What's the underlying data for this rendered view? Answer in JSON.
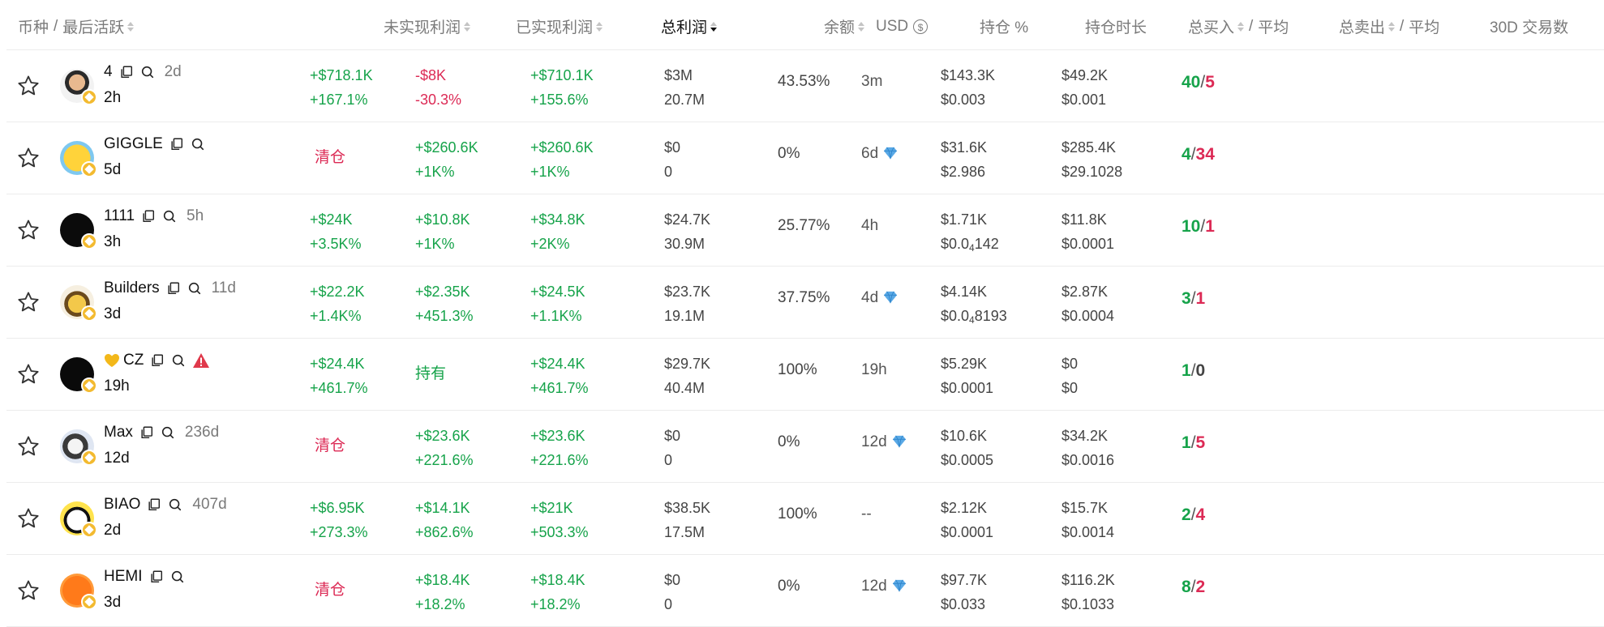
{
  "header": {
    "token_col": "币种",
    "last_active": "最后活跃",
    "unrealized": "未实现利润",
    "realized": "已实现利润",
    "total_profit": "总利润",
    "balance": "余额",
    "currency": "USD",
    "currency_symbol": "$",
    "holding_pct": "持仓 %",
    "hold_duration": "持仓时长",
    "total_buy": "总买入",
    "buy_avg": "平均",
    "total_sell": "总卖出",
    "sell_avg": "平均",
    "trades_30d": "30D 交易数"
  },
  "colors": {
    "green": "#16a34a",
    "red": "#dc2a55",
    "bnb": "#f3ba2f"
  },
  "rows": [
    {
      "name": "4",
      "age": "2d",
      "last_active": "2h",
      "unrealized": {
        "mode": "two",
        "v1": "+$718.1K",
        "v2": "+167.1%",
        "c1": "g",
        "c2": "g"
      },
      "realized": {
        "mode": "two",
        "v1": "-$8K",
        "v2": "-30.3%",
        "c1": "r",
        "c2": "r"
      },
      "total": {
        "v1": "+$710.1K",
        "v2": "+155.6%"
      },
      "balance": {
        "v1": "$3M",
        "v2": "20.7M"
      },
      "holding_pct": "43.53%",
      "hold_duration": "3m",
      "diamond": false,
      "buy": {
        "v1": "$143.3K",
        "v2": "$0.003"
      },
      "sell": {
        "v1": "$49.2K",
        "v2": "$0.001"
      },
      "trades": {
        "buys": "40",
        "sells": "5"
      },
      "avatar": "man",
      "warn": false,
      "heart": false
    },
    {
      "name": "GIGGLE",
      "age": "",
      "last_active": "5d",
      "unrealized": {
        "mode": "one",
        "v1": "清仓",
        "c1": "r"
      },
      "realized": {
        "mode": "two",
        "v1": "+$260.6K",
        "v2": "+1K%",
        "c1": "g",
        "c2": "g"
      },
      "total": {
        "v1": "+$260.6K",
        "v2": "+1K%"
      },
      "balance": {
        "v1": "$0",
        "v2": "0"
      },
      "holding_pct": "0%",
      "hold_duration": "6d",
      "diamond": true,
      "buy": {
        "v1": "$31.6K",
        "v2": "$2.986"
      },
      "sell": {
        "v1": "$285.4K",
        "v2": "$29.1028"
      },
      "trades": {
        "buys": "4",
        "sells": "34"
      },
      "avatar": "giggle",
      "warn": false,
      "heart": false
    },
    {
      "name": "1111",
      "age": "5h",
      "last_active": "3h",
      "unrealized": {
        "mode": "two",
        "v1": "+$24K",
        "v2": "+3.5K%",
        "c1": "g",
        "c2": "g"
      },
      "realized": {
        "mode": "two",
        "v1": "+$10.8K",
        "v2": "+1K%",
        "c1": "g",
        "c2": "g"
      },
      "total": {
        "v1": "+$34.8K",
        "v2": "+2K%"
      },
      "balance": {
        "v1": "$24.7K",
        "v2": "30.9M"
      },
      "holding_pct": "25.77%",
      "hold_duration": "4h",
      "diamond": false,
      "buy": {
        "v1": "$1.71K",
        "v2_pre": "$0.0",
        "v2_sub": "4",
        "v2_post": "142"
      },
      "sell": {
        "v1": "$11.8K",
        "v2": "$0.0001"
      },
      "trades": {
        "buys": "10",
        "sells": "1"
      },
      "avatar": "dark",
      "warn": false,
      "heart": false
    },
    {
      "name": "Builders",
      "age": "11d",
      "last_active": "3d",
      "unrealized": {
        "mode": "two",
        "v1": "+$22.2K",
        "v2": "+1.4K%",
        "c1": "g",
        "c2": "g"
      },
      "realized": {
        "mode": "two",
        "v1": "+$2.35K",
        "v2": "+451.3%",
        "c1": "g",
        "c2": "g"
      },
      "total": {
        "v1": "+$24.5K",
        "v2": "+1.1K%"
      },
      "balance": {
        "v1": "$23.7K",
        "v2": "19.1M"
      },
      "holding_pct": "37.75%",
      "hold_duration": "4d",
      "diamond": true,
      "buy": {
        "v1": "$4.14K",
        "v2_pre": "$0.0",
        "v2_sub": "4",
        "v2_post": "8193"
      },
      "sell": {
        "v1": "$2.87K",
        "v2": "$0.0004"
      },
      "trades": {
        "buys": "3",
        "sells": "1"
      },
      "avatar": "builder",
      "warn": false,
      "heart": false
    },
    {
      "name": "CZ",
      "age": "",
      "last_active": "19h",
      "unrealized": {
        "mode": "two",
        "v1": "+$24.4K",
        "v2": "+461.7%",
        "c1": "g",
        "c2": "g"
      },
      "realized": {
        "mode": "one",
        "v1": "持有",
        "c1": "g"
      },
      "total": {
        "v1": "+$24.4K",
        "v2": "+461.7%"
      },
      "balance": {
        "v1": "$29.7K",
        "v2": "40.4M"
      },
      "holding_pct": "100%",
      "hold_duration": "19h",
      "diamond": false,
      "buy": {
        "v1": "$5.29K",
        "v2": "$0.0001"
      },
      "sell": {
        "v1": "$0",
        "v2": "$0"
      },
      "trades": {
        "buys": "1",
        "sells": "0"
      },
      "avatar": "cz",
      "warn": true,
      "heart": true
    },
    {
      "name": "Max",
      "age": "236d",
      "last_active": "12d",
      "unrealized": {
        "mode": "one",
        "v1": "清仓",
        "c1": "r"
      },
      "realized": {
        "mode": "two",
        "v1": "+$23.6K",
        "v2": "+221.6%",
        "c1": "g",
        "c2": "g"
      },
      "total": {
        "v1": "+$23.6K",
        "v2": "+221.6%"
      },
      "balance": {
        "v1": "$0",
        "v2": "0"
      },
      "holding_pct": "0%",
      "hold_duration": "12d",
      "diamond": true,
      "buy": {
        "v1": "$10.6K",
        "v2": "$0.0005"
      },
      "sell": {
        "v1": "$34.2K",
        "v2": "$0.0016"
      },
      "trades": {
        "buys": "1",
        "sells": "5"
      },
      "avatar": "max",
      "warn": false,
      "heart": false
    },
    {
      "name": "BIAO",
      "age": "407d",
      "last_active": "2d",
      "unrealized": {
        "mode": "two",
        "v1": "+$6.95K",
        "v2": "+273.3%",
        "c1": "g",
        "c2": "g"
      },
      "realized": {
        "mode": "two",
        "v1": "+$14.1K",
        "v2": "+862.6%",
        "c1": "g",
        "c2": "g"
      },
      "total": {
        "v1": "+$21K",
        "v2": "+503.3%"
      },
      "balance": {
        "v1": "$38.5K",
        "v2": "17.5M"
      },
      "holding_pct": "100%",
      "hold_duration": "--",
      "diamond": false,
      "buy": {
        "v1": "$2.12K",
        "v2": "$0.0001"
      },
      "sell": {
        "v1": "$15.7K",
        "v2": "$0.0014"
      },
      "trades": {
        "buys": "2",
        "sells": "4"
      },
      "avatar": "panda",
      "warn": false,
      "heart": false
    },
    {
      "name": "HEMI",
      "age": "",
      "last_active": "3d",
      "unrealized": {
        "mode": "one",
        "v1": "清仓",
        "c1": "r"
      },
      "realized": {
        "mode": "two",
        "v1": "+$18.4K",
        "v2": "+18.2%",
        "c1": "g",
        "c2": "g"
      },
      "total": {
        "v1": "+$18.4K",
        "v2": "+18.2%"
      },
      "balance": {
        "v1": "$0",
        "v2": "0"
      },
      "holding_pct": "0%",
      "hold_duration": "12d",
      "diamond": true,
      "buy": {
        "v1": "$97.7K",
        "v2": "$0.033"
      },
      "sell": {
        "v1": "$116.2K",
        "v2": "$0.1033"
      },
      "trades": {
        "buys": "8",
        "sells": "2"
      },
      "avatar": "hemi",
      "warn": false,
      "heart": false
    }
  ]
}
